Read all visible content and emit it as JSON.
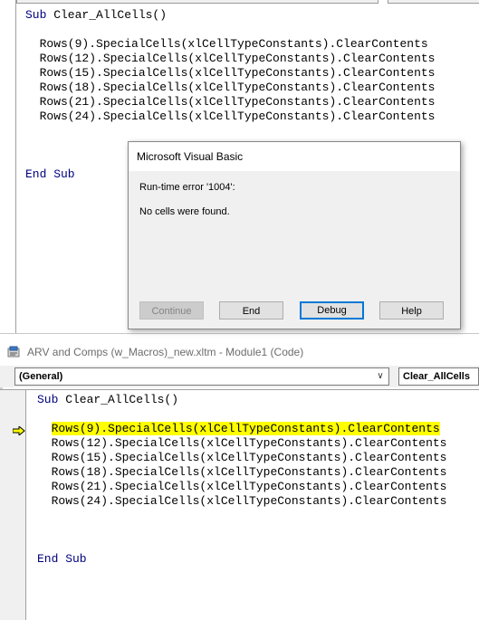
{
  "top_editor": {
    "lines": [
      {
        "kw": "Sub",
        "text": " Clear_AllCells()"
      },
      {
        "text": ""
      },
      {
        "text": "  Rows(9).SpecialCells(xlCellTypeConstants).ClearContents"
      },
      {
        "text": "  Rows(12).SpecialCells(xlCellTypeConstants).ClearContents"
      },
      {
        "text": "  Rows(15).SpecialCells(xlCellTypeConstants).ClearContents"
      },
      {
        "text": "  Rows(18).SpecialCells(xlCellTypeConstants).ClearContents"
      },
      {
        "text": "  Rows(21).SpecialCells(xlCellTypeConstants).ClearContents"
      },
      {
        "text": "  Rows(24).SpecialCells(xlCellTypeConstants).ClearContents"
      }
    ],
    "end_line": {
      "kw": "End Sub"
    }
  },
  "dialog": {
    "title": "Microsoft Visual Basic",
    "error_line": "Run-time error '1004':",
    "message": "No cells were found.",
    "buttons": {
      "continue": "Continue",
      "end": "End",
      "debug": "Debug",
      "help": "Help"
    }
  },
  "bottom_window": {
    "title": "ARV and Comps (w_Macros)_new.xltm - Module1 (Code)",
    "object_combo": "(General)",
    "procedure_combo": "Clear_AllCells",
    "lines": [
      {
        "kw": "Sub",
        "text": " Clear_AllCells()"
      },
      {
        "text": ""
      },
      {
        "text": "  Rows(9).SpecialCells(xlCellTypeConstants).ClearContents",
        "highlight": true
      },
      {
        "text": "  Rows(12).SpecialCells(xlCellTypeConstants).ClearContents"
      },
      {
        "text": "  Rows(15).SpecialCells(xlCellTypeConstants).ClearContents"
      },
      {
        "text": "  Rows(18).SpecialCells(xlCellTypeConstants).ClearContents"
      },
      {
        "text": "  Rows(21).SpecialCells(xlCellTypeConstants).ClearContents"
      },
      {
        "text": "  Rows(24).SpecialCells(xlCellTypeConstants).ClearContents"
      }
    ],
    "end_line": {
      "kw": "End Sub"
    }
  },
  "colors": {
    "keyword": "#00007f",
    "highlight": "#ffff00",
    "default_button_border": "#0078d7"
  }
}
